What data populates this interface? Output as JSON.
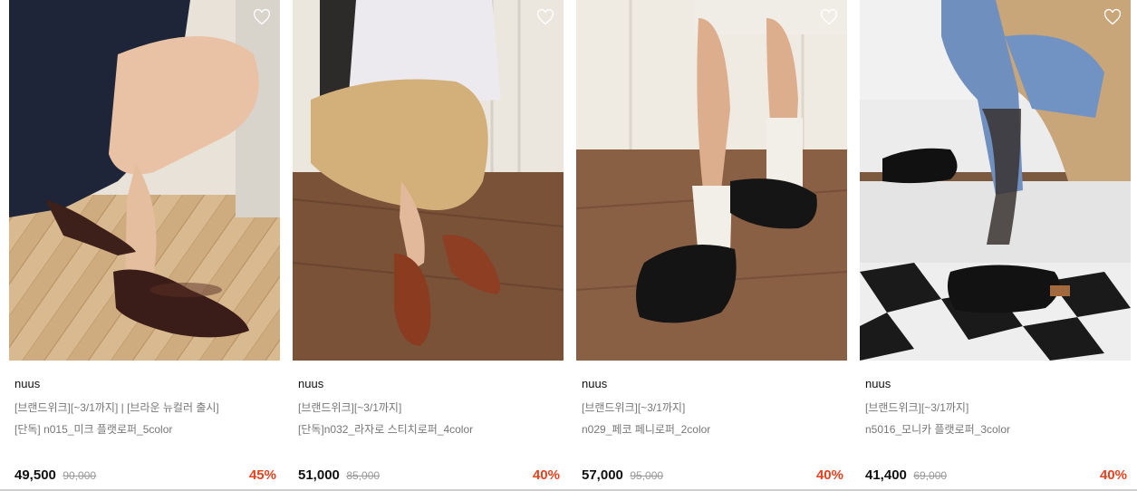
{
  "products": [
    {
      "brand": "nuus",
      "promo": "[브랜드위크][~3/1까지] | [브라운 뉴컬러 출시]",
      "name": "[단독] n015_미크 플랫로퍼_5color",
      "price": "49,500",
      "original_price": "90,000",
      "discount": "45%",
      "image": "woman-wearing-dark-brown-flat-loafers-on-parquet-floor",
      "icon": "heart-outline-icon"
    },
    {
      "brand": "nuus",
      "promo": "[브랜드위크][~3/1까지]",
      "name": "[단독]n032_라자로 스티치로퍼_4color",
      "price": "51,000",
      "original_price": "85,000",
      "discount": "40%",
      "image": "woman-sitting-wearing-brown-stitched-loafers",
      "icon": "heart-outline-icon"
    },
    {
      "brand": "nuus",
      "promo": "[브랜드위크][~3/1까지]",
      "name": "n029_페코 페니로퍼_2color",
      "price": "57,000",
      "original_price": "95,000",
      "discount": "40%",
      "image": "legs-with-white-socks-and-black-penny-loafers",
      "icon": "heart-outline-icon"
    },
    {
      "brand": "nuus",
      "promo": "[브랜드위크][~3/1까지]",
      "name": "n5016_모니카 플랫로퍼_3color",
      "price": "41,400",
      "original_price": "69,000",
      "discount": "40%",
      "image": "person-on-stairs-wearing-black-flat-loafers-with-sheer-socks",
      "icon": "heart-outline-icon"
    }
  ],
  "colors": {
    "discount": "#e8411e",
    "price": "#111111",
    "muted_text": "#777777",
    "strike_price": "#999999"
  }
}
